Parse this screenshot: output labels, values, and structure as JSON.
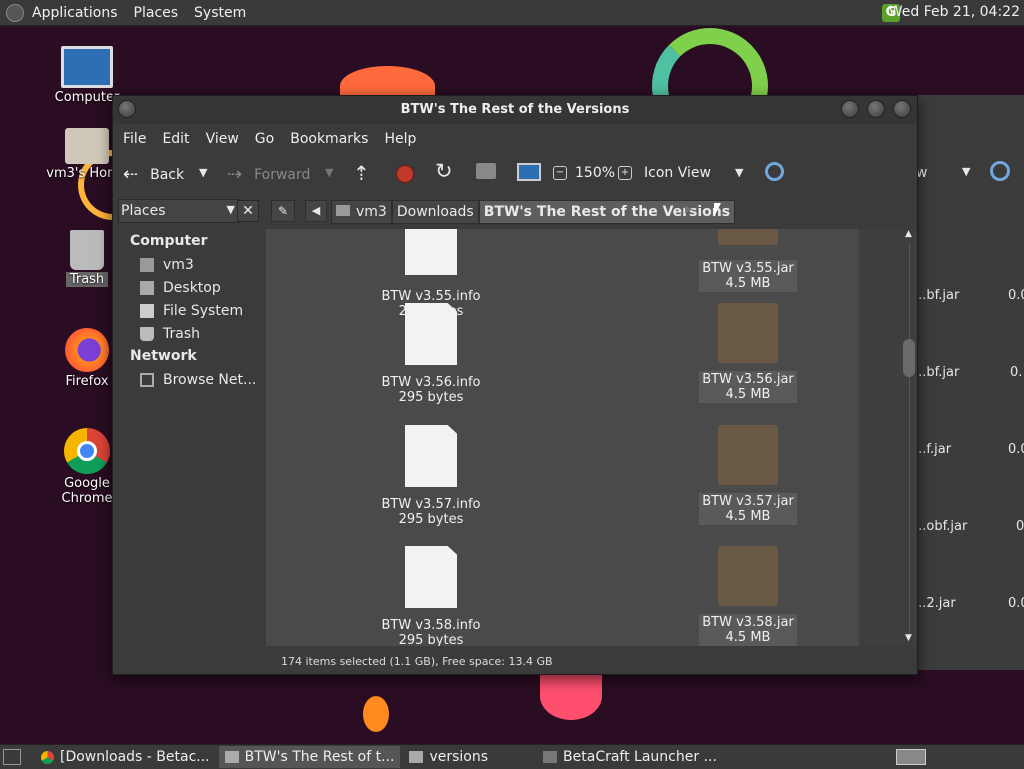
{
  "panel": {
    "menus": [
      "Applications",
      "Places",
      "System"
    ],
    "clock": "Wed Feb 21, 04:22"
  },
  "desktop": {
    "icons": [
      {
        "label": "Computer",
        "icon": "computer-icon"
      },
      {
        "label": "vm3's Home",
        "icon": "home-folder-icon"
      },
      {
        "label": "Trash",
        "icon": "trash-icon"
      },
      {
        "label": "Firefox",
        "icon": "firefox-icon"
      },
      {
        "label": "Google Chrome",
        "icon": "chrome-icon"
      }
    ]
  },
  "background_window": {
    "files": [
      {
        "name": "...bf.jar",
        "size": "0.0"
      },
      {
        "name": "...bf.jar",
        "size": "0."
      },
      {
        "name": "...f.jar",
        "size": "0.0"
      },
      {
        "name": "...obf.jar",
        "size": "0"
      },
      {
        "name": "...2.jar",
        "size": "0.0"
      }
    ],
    "view_label": "w"
  },
  "window": {
    "title": "BTW's The Rest of the Versions",
    "menus": [
      "File",
      "Edit",
      "View",
      "Go",
      "Bookmarks",
      "Help"
    ],
    "toolbar": {
      "back": "Back",
      "forward": "Forward",
      "zoom": "150%",
      "view_mode": "Icon View"
    },
    "location": {
      "places_label": "Places",
      "crumbs": [
        "vm3",
        "Downloads",
        "BTW's The Rest of the Versions"
      ]
    },
    "sidebar": {
      "sections": [
        {
          "heading": "Computer",
          "items": [
            "vm3",
            "Desktop",
            "File System",
            "Trash"
          ]
        },
        {
          "heading": "Network",
          "items": [
            "Browse Net..."
          ]
        }
      ]
    },
    "files": [
      {
        "name": "BTW v3.55.info",
        "size": "295 bytes"
      },
      {
        "name": "BTW v3.55.jar",
        "size": "4.5 MB"
      },
      {
        "name": "BTW v3.56.info",
        "size": "295 bytes"
      },
      {
        "name": "BTW v3.56.jar",
        "size": "4.5 MB"
      },
      {
        "name": "BTW v3.57.info",
        "size": "295 bytes"
      },
      {
        "name": "BTW v3.57.jar",
        "size": "4.5 MB"
      },
      {
        "name": "BTW v3.58.info",
        "size": "295 bytes"
      },
      {
        "name": "BTW v3.58.jar",
        "size": "4.5 MB"
      }
    ],
    "status": "174 items selected (1.1 GB), Free space: 13.4 GB"
  },
  "taskbar": {
    "tasks": [
      {
        "label": "[Downloads - Betac...",
        "icon": "chrome-icon"
      },
      {
        "label": "BTW's The Rest of t...",
        "icon": "folder-icon"
      },
      {
        "label": "versions",
        "icon": "folder-icon"
      },
      {
        "label": "BetaCraft Launcher ...",
        "icon": "app-icon"
      }
    ]
  },
  "colors": {
    "accent_green": "#5aa02c",
    "stop_red": "#c0392b",
    "panel": "#3a3a3a"
  }
}
